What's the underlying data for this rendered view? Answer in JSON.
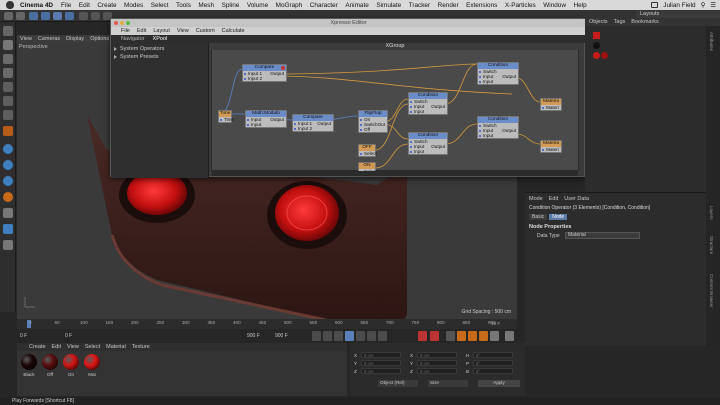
{
  "menubar": {
    "app": "Cinema 4D",
    "items": [
      "File",
      "Edit",
      "Create",
      "Modes",
      "Select",
      "Tools",
      "Mesh",
      "Spline",
      "Volume",
      "MoGraph",
      "Character",
      "Animate",
      "Simulate",
      "Tracker",
      "Render",
      "Extensions",
      "X-Particles",
      "Window",
      "Help"
    ],
    "user": "Julian Field"
  },
  "layouts_label": "Layouts",
  "viewport": {
    "menu": [
      "View",
      "Cameras",
      "Display",
      "Options"
    ],
    "label": "Perspective",
    "grid_spacing": "Grid Spacing : 500 cm"
  },
  "xpresso": {
    "title": "Xpresso Editor",
    "menu": [
      "File",
      "Edit",
      "Layout",
      "View",
      "Custom",
      "Calculate"
    ],
    "tabs": [
      "Navigator",
      "XPool"
    ],
    "pool": [
      "System Operators",
      "System Presets"
    ],
    "graph_title": "XGroup",
    "nodes": {
      "compare1": {
        "title": "Compare",
        "ports": [
          "Input 1",
          "Input 2"
        ],
        "out": "Output"
      },
      "math": {
        "title": "Math:Modulo",
        "ports": [
          "Input",
          "Input"
        ],
        "out": "Output"
      },
      "compare2": {
        "title": "Compare",
        "ports": [
          "Input 1",
          "Input 2"
        ],
        "out": "Output"
      },
      "flipflop": {
        "title": "FlipFlop",
        "ports": [
          "On",
          "Switch",
          "Off"
        ],
        "out": "Out"
      },
      "off": {
        "title": "OFF",
        "ports": [
          "Select"
        ]
      },
      "on": {
        "title": "ON",
        "ports": [
          "Select"
        ]
      },
      "cond1": {
        "title": "Condition",
        "ports": [
          "Switch",
          "Input",
          "Input"
        ],
        "out": "Output"
      },
      "cond2": {
        "title": "Condition",
        "ports": [
          "Switch",
          "Input",
          "Input"
        ],
        "out": "Output"
      },
      "cond3": {
        "title": "Condition",
        "ports": [
          "Switch",
          "Input",
          "Input"
        ],
        "out": "Output"
      },
      "cond4": {
        "title": "Condition",
        "ports": [
          "Switch",
          "Input",
          "Input"
        ],
        "out": "Output"
      },
      "mat1": {
        "title": "Materia",
        "ports": [
          "Materi"
        ]
      },
      "mat2": {
        "title": "Materia",
        "ports": [
          "Materi"
        ]
      },
      "time": {
        "title": "Time",
        "ports": [
          "Time"
        ]
      }
    }
  },
  "objmgr": {
    "tabs": [
      "Objects",
      "Tags",
      "Bookmarks"
    ]
  },
  "attributes": {
    "menu": [
      "Mode",
      "Edit",
      "User Data"
    ],
    "object_line": "Condition Operator (3 Elements) [Condition, Condition]",
    "tabs": [
      "Basic",
      "Node"
    ],
    "section": "Node Properties",
    "field_label": "Data Type",
    "field_value": "Material"
  },
  "timeline": {
    "ticks": [
      "0",
      "50",
      "100",
      "150",
      "200",
      "250",
      "300",
      "350",
      "400",
      "450",
      "500",
      "550",
      "600",
      "650",
      "700",
      "750",
      "800",
      "850",
      "900"
    ],
    "current": "0 F",
    "start": "0 F",
    "end": "900 F",
    "end2": "900 F",
    "frame_right": "16 F"
  },
  "materials": {
    "menu": [
      "Create",
      "Edit",
      "View",
      "Select",
      "Material",
      "Texture"
    ],
    "items": [
      {
        "name": "Black",
        "color": "#1a0606"
      },
      {
        "name": "Off",
        "color": "#5a0d0d"
      },
      {
        "name": "On",
        "color": "#d41414"
      },
      {
        "name": "Mat",
        "color": "#e01616"
      }
    ]
  },
  "coords": {
    "rows": [
      [
        "X",
        "0 cm",
        "X",
        "0 cm",
        "H",
        "0°"
      ],
      [
        "Y",
        "0 cm",
        "Y",
        "0 cm",
        "P",
        "0°"
      ],
      [
        "Z",
        "0 cm",
        "Z",
        "0 cm",
        "B",
        "0°"
      ]
    ],
    "dropdown1": "Object (Rel)",
    "dropdown2": "Size",
    "apply": "Apply"
  },
  "status": "Play Forwards [Shortcut F8]",
  "side_tabs": [
    "Attributes",
    "Layers",
    "Structure",
    "Content Browser"
  ]
}
